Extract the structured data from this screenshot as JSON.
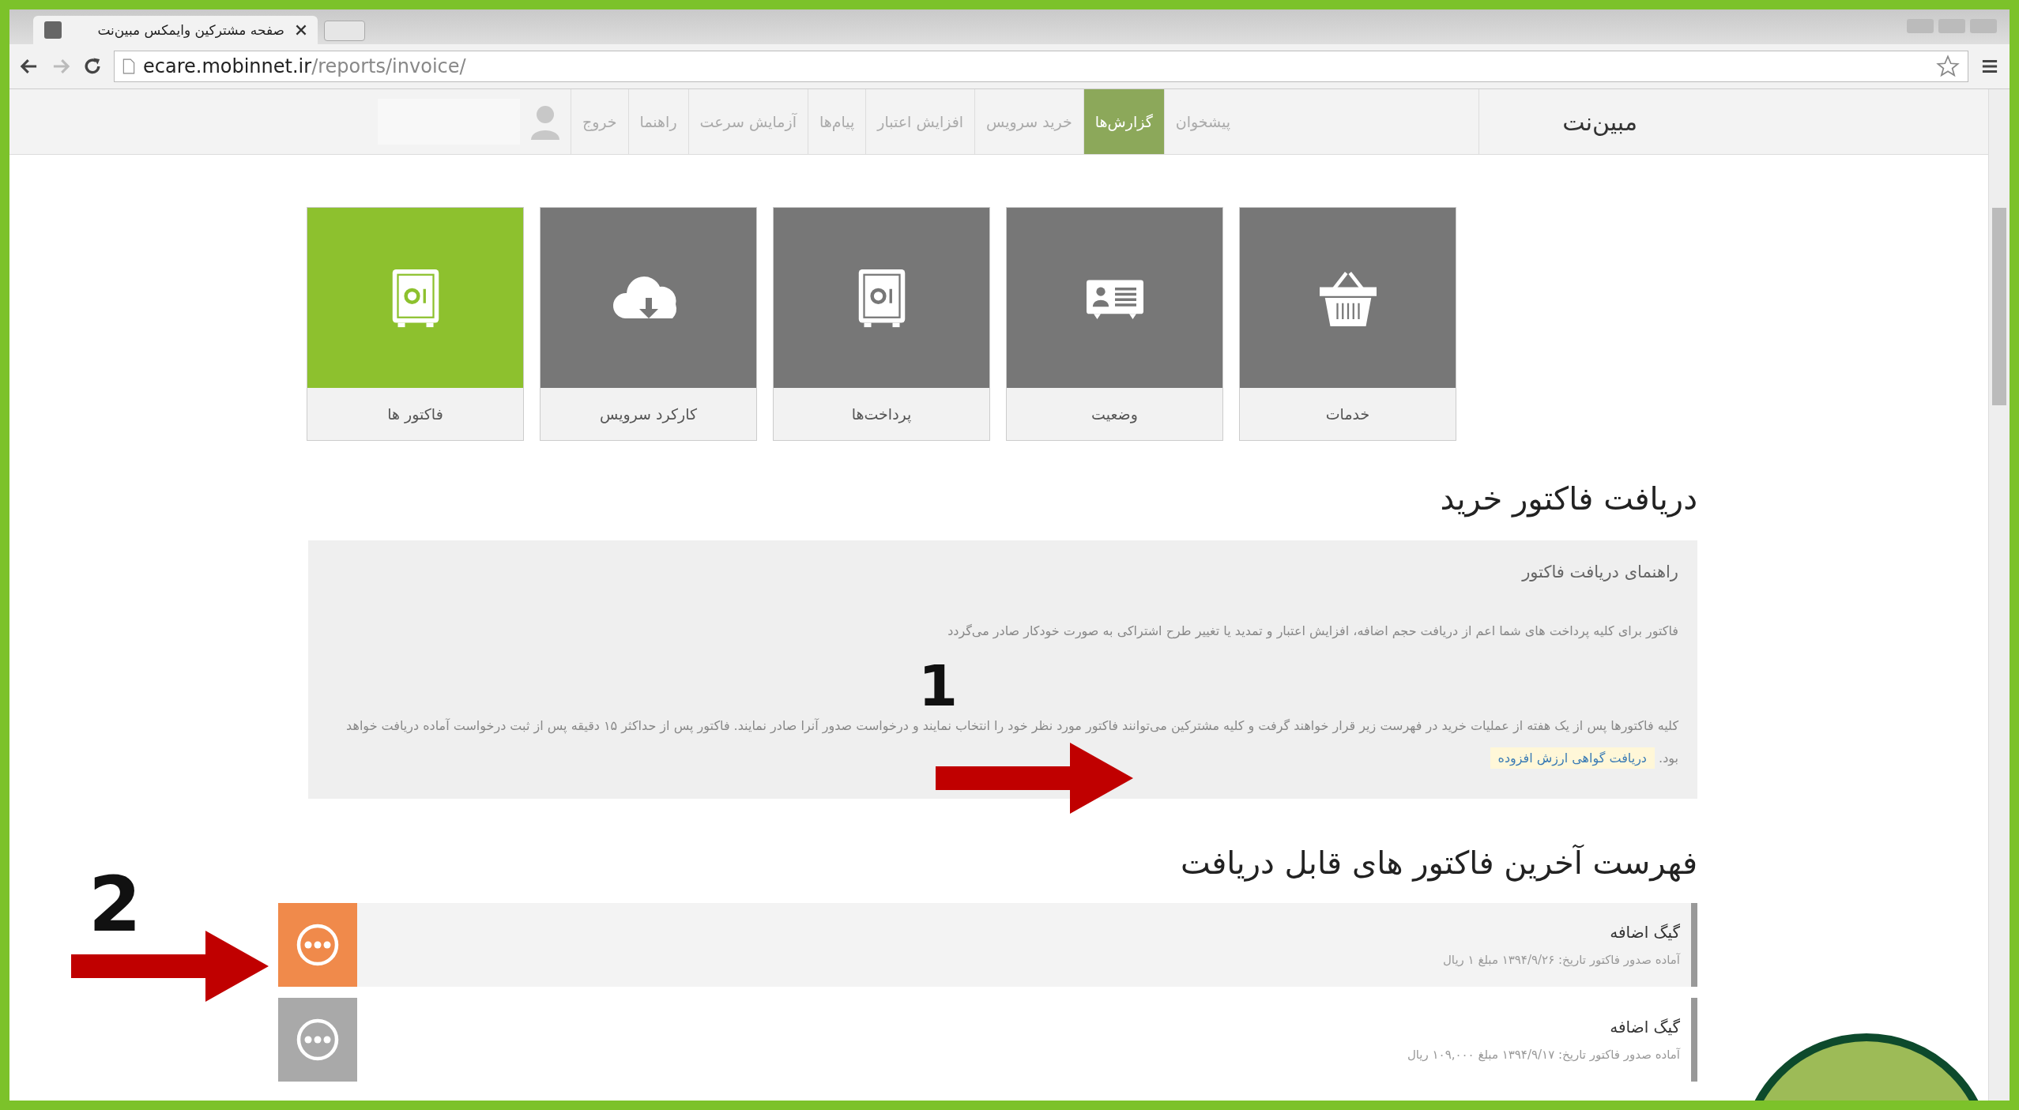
{
  "browser": {
    "tab_title": "صفحه مشترکین وایمکس مبین‌نت",
    "url_host": "ecare.mobinnet.ir",
    "url_path": "/reports/invoice/"
  },
  "nav": {
    "brand": "مبین‌نت",
    "items": [
      {
        "label": "پیشخوان",
        "selected": false
      },
      {
        "label": "گزارش‌ها",
        "selected": true
      },
      {
        "label": "خرید سرویس",
        "selected": false
      },
      {
        "label": "افزایش اعتبار",
        "selected": false
      },
      {
        "label": "پیام‌ها",
        "selected": false
      },
      {
        "label": "آزمایش سرعت",
        "selected": false
      },
      {
        "label": "راهنما",
        "selected": false
      },
      {
        "label": "خروج",
        "selected": false
      }
    ]
  },
  "tiles": [
    {
      "label": "خدمات",
      "kind": "basket",
      "selected": false
    },
    {
      "label": "وضعیت",
      "kind": "card",
      "selected": false
    },
    {
      "label": "پرداخت‌ها",
      "kind": "safe",
      "selected": false
    },
    {
      "label": "کارکرد سرویس",
      "kind": "cloud",
      "selected": false
    },
    {
      "label": "فاکتور ها",
      "kind": "safe",
      "selected": true
    }
  ],
  "invoice_section": {
    "heading": "دریافت فاکتور خرید",
    "guide_title": "راهنمای دریافت فاکتور",
    "paragraphs": [
      "فاکتور برای کلیه پرداخت های شما اعم از دریافت حجم اضافه، افزایش اعتبار و تمدید یا تغییر طرح اشتراکی به صورت خودکار صادر می‌گردد",
      "کلیه فاکتورها پس از یک هفته از عملیات خرید در فهرست زیر قرار خواهند گرفت و کلیه مشترکین می‌توانند فاکتور مورد نظر خود را انتخاب نمایند و درخواست صدور آنرا صادر نمایند. فاکتور پس از حداکثر ۱۵ دقیقه پس از ثبت درخواست آماده دریافت خواهد بود."
    ],
    "link": "دریافت گواهی ارزش افزوده"
  },
  "list_section": {
    "heading": "فهرست آخرین فاکتور های قابل دریافت",
    "rows": [
      {
        "title": "گیگ اضافه",
        "detail": "آماده صدور فاکتور تاریخ: ۱۳۹۴/۹/۲۶ مبلغ ۱ ریال",
        "selected": true
      },
      {
        "title": "گیگ اضافه",
        "detail": "آماده صدور فاکتور تاریخ: ۱۳۹۴/۹/۱۷ مبلغ ۱۰۹,۰۰۰ ریال",
        "selected": false
      }
    ]
  },
  "annotations": [
    {
      "label": "1"
    },
    {
      "label": "2"
    }
  ]
}
